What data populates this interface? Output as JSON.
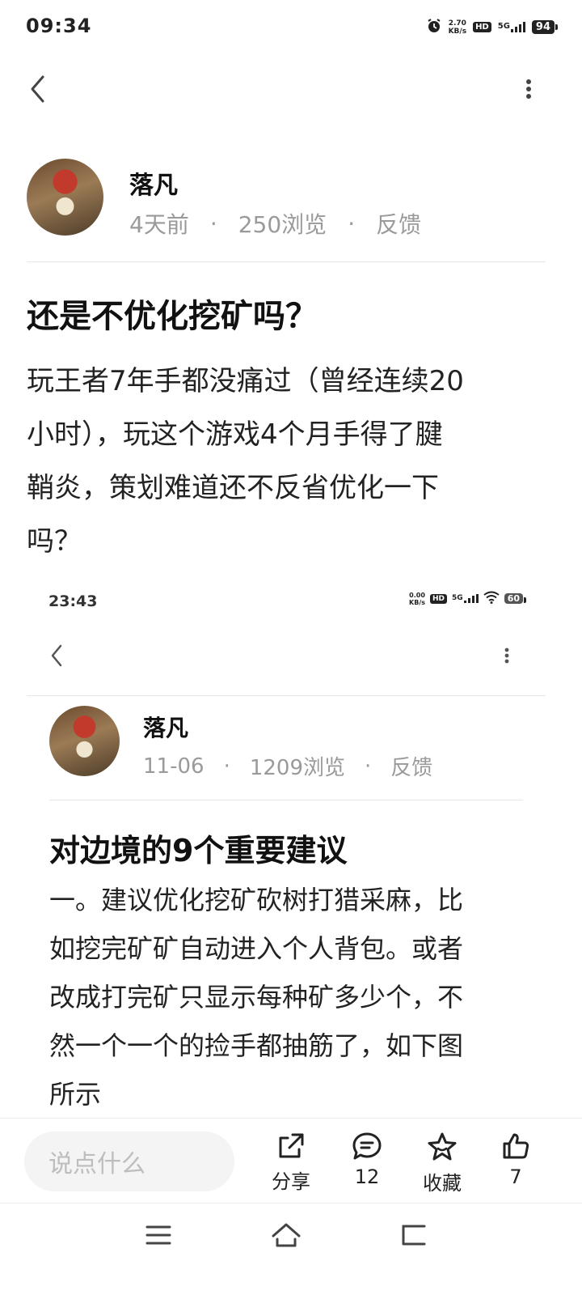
{
  "status_bar": {
    "time": "09:34",
    "speed_value": "2.70",
    "speed_unit": "KB/s",
    "hd": "HD",
    "network": "5G",
    "battery": "94"
  },
  "author": {
    "name": "落凡",
    "time_ago": "4天前",
    "views": "250浏览",
    "feedback": "反馈"
  },
  "post": {
    "title": "还是不优化挖矿吗？",
    "body_lines": [
      "玩王者7年手都没痛过（曾经连续20",
      "小时），玩这个游戏4个月手得了腱",
      "鞘炎，策划难道还不反省优化一下",
      "吗？"
    ]
  },
  "embedded": {
    "status_bar": {
      "time": "23:43",
      "speed_value": "0.00",
      "speed_unit": "KB/s",
      "hd": "HD",
      "network": "5G",
      "battery": "60"
    },
    "author": {
      "name": "落凡",
      "date": "11-06",
      "views": "1209浏览",
      "feedback": "反馈"
    },
    "post": {
      "title": "对边境的9个重要建议",
      "body_lines": [
        "一。建议优化挖矿砍树打猎采麻，比",
        "如挖完矿矿自动进入个人背包。或者",
        "改成打完矿只显示每种矿多少个，不",
        "然一个一个的捡手都抽筋了，如下图",
        "所示"
      ]
    }
  },
  "bottom_bar": {
    "comment_placeholder": "说点什么",
    "share_label": "分享",
    "comments_count": "12",
    "favorite_label": "收藏",
    "likes_count": "7"
  }
}
